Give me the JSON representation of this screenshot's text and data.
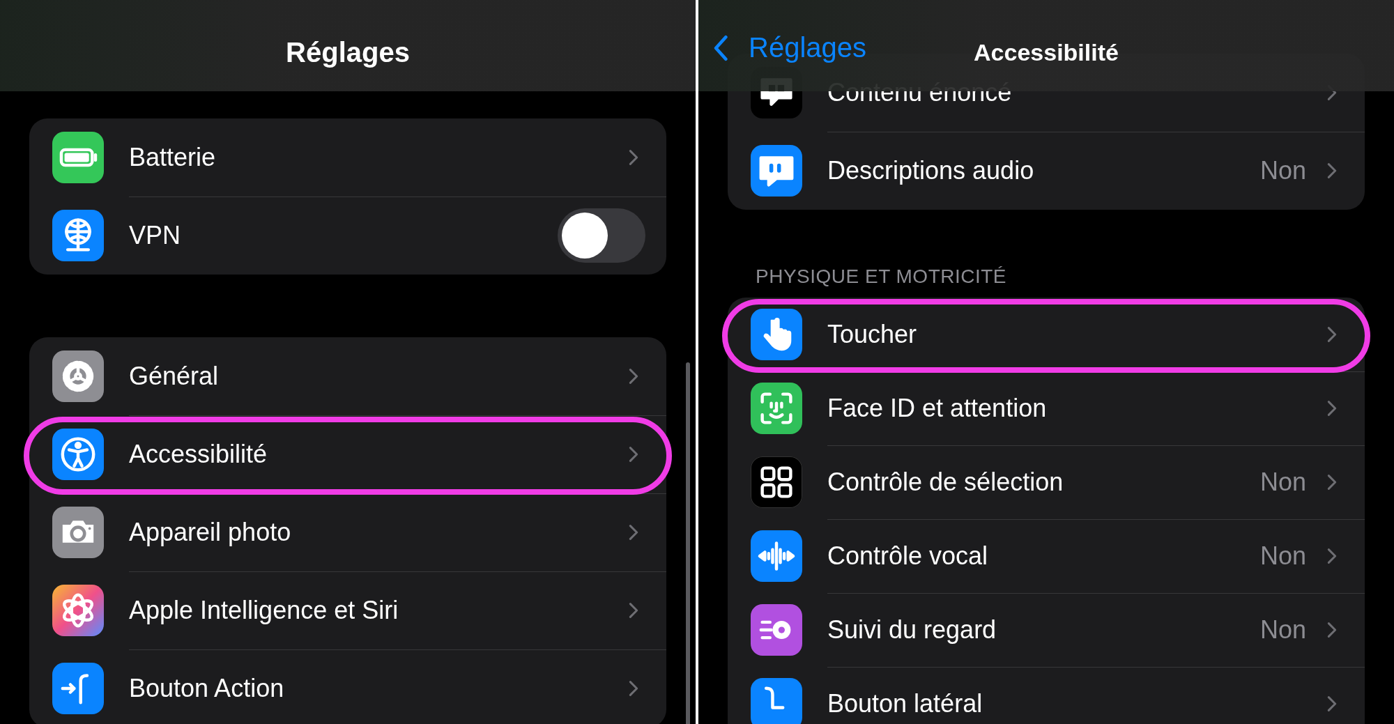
{
  "left": {
    "title": "Réglages",
    "groups": [
      {
        "items": [
          {
            "label": "Batterie",
            "kind": "link",
            "circled": false
          },
          {
            "label": "VPN",
            "kind": "toggle",
            "on": false,
            "circled": false
          }
        ]
      },
      {
        "items": [
          {
            "label": "Général",
            "kind": "link",
            "circled": false
          },
          {
            "label": "Accessibilité",
            "kind": "link",
            "circled": true
          },
          {
            "label": "Appareil photo",
            "kind": "link",
            "circled": false
          },
          {
            "label": "Apple Intelligence et Siri",
            "kind": "link",
            "circled": false
          },
          {
            "label": "Bouton Action",
            "kind": "link",
            "circled": false
          }
        ]
      }
    ]
  },
  "right": {
    "back": "Réglages",
    "title": "Accessibilité",
    "groups": [
      {
        "items": [
          {
            "label": "Contenu énoncé",
            "kind": "link",
            "circled": false
          },
          {
            "label": "Descriptions audio",
            "kind": "link",
            "value": "Non",
            "circled": false
          }
        ]
      },
      {
        "header": "PHYSIQUE ET MOTRICITÉ",
        "items": [
          {
            "label": "Toucher",
            "kind": "link",
            "circled": true
          },
          {
            "label": "Face ID et attention",
            "kind": "link",
            "circled": false
          },
          {
            "label": "Contrôle de sélection",
            "kind": "link",
            "value": "Non",
            "circled": false
          },
          {
            "label": "Contrôle vocal",
            "kind": "link",
            "value": "Non",
            "circled": false
          },
          {
            "label": "Suivi du regard",
            "kind": "link",
            "value": "Non",
            "circled": false
          },
          {
            "label": "Bouton latéral",
            "kind": "link",
            "circled": false
          }
        ]
      }
    ]
  }
}
